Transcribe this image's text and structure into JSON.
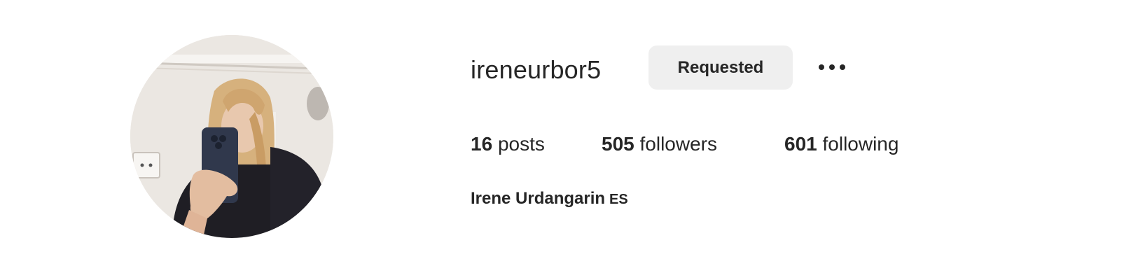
{
  "profile": {
    "username": "ireneurbor5",
    "follow_button_label": "Requested",
    "more_icon": "more-horizontal-icon",
    "full_name": "Irene Urdangarin",
    "name_suffix": "ES",
    "avatar_icon": "profile-photo"
  },
  "stats": {
    "posts": {
      "count": "16",
      "label": "posts"
    },
    "followers": {
      "count": "505",
      "label": "followers"
    },
    "following": {
      "count": "601",
      "label": "following"
    }
  }
}
